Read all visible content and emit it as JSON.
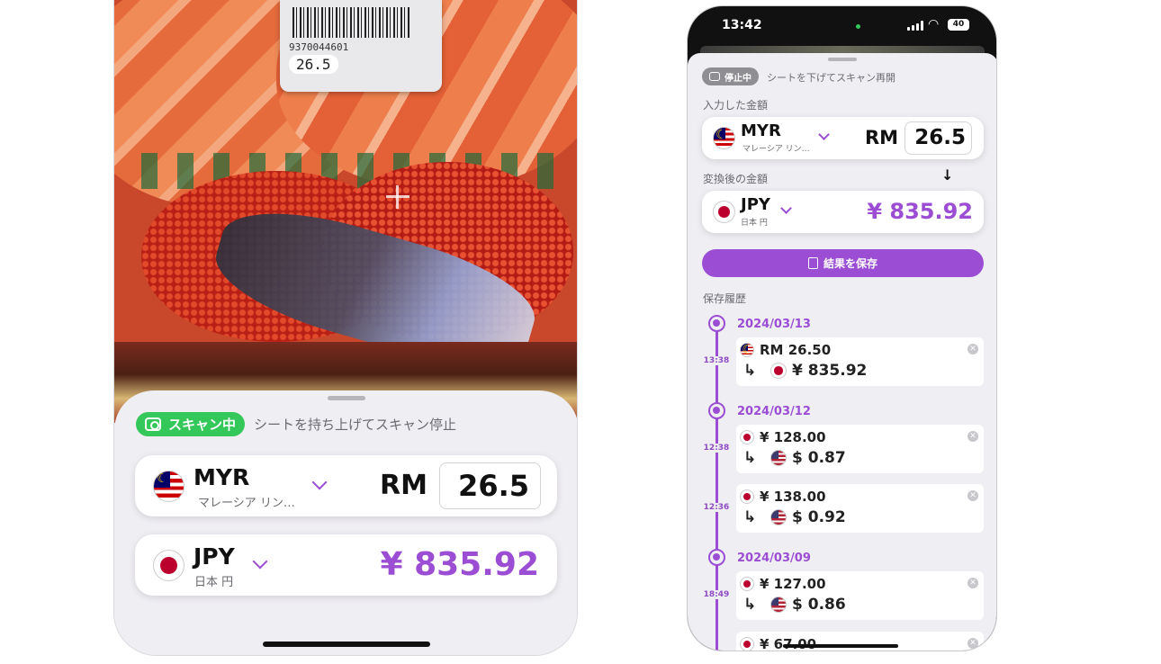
{
  "left_phone": {
    "price_label": {
      "barcode_number": "9370044601",
      "price": "26.5"
    },
    "sheet": {
      "status_pill": "スキャン中",
      "status_hint": "シートを持ち上げてスキャン停止",
      "input": {
        "code": "MYR",
        "name": "マレーシア リン…",
        "symbol": "RM",
        "value": "26.5"
      },
      "output": {
        "code": "JPY",
        "name": "日本 円",
        "amount": "¥ 835.92"
      }
    }
  },
  "right_phone": {
    "status_bar": {
      "time": "13:42",
      "battery": "40"
    },
    "sheet": {
      "status_pill": "停止中",
      "status_hint": "シートを下げてスキャン再開",
      "input_label": "入力した金額",
      "input": {
        "code": "MYR",
        "name": "マレーシア リン…",
        "symbol": "RM",
        "value": "26.5"
      },
      "output_label": "変換後の金額",
      "output": {
        "code": "JPY",
        "name": "日本 円",
        "amount": "¥ 835.92"
      },
      "save_button": "結果を保存",
      "history_label": "保存履歴",
      "history": [
        {
          "date": "2024/03/13",
          "time": "13:38",
          "from_flag": "my",
          "from": "RM 26.50",
          "to_flag": "jp",
          "to": "¥ 835.92"
        },
        {
          "date": "2024/03/12",
          "time": "12:38",
          "from_flag": "jp",
          "from": "¥ 128.00",
          "to_flag": "us",
          "to": "$ 0.87"
        },
        {
          "date": "",
          "time": "12:36",
          "from_flag": "jp",
          "from": "¥ 138.00",
          "to_flag": "us",
          "to": "$ 0.92"
        },
        {
          "date": "2024/03/09",
          "time": "18:49",
          "from_flag": "jp",
          "from": "¥ 127.00",
          "to_flag": "us",
          "to": "$ 0.86"
        },
        {
          "date": "",
          "time": "",
          "from_flag": "jp",
          "from": "¥ 67.00",
          "to_flag": "",
          "to": ""
        }
      ]
    }
  },
  "colors": {
    "accent": "#9b4dd4",
    "scan_green": "#34c759",
    "sheet_bg": "#efeef3"
  }
}
